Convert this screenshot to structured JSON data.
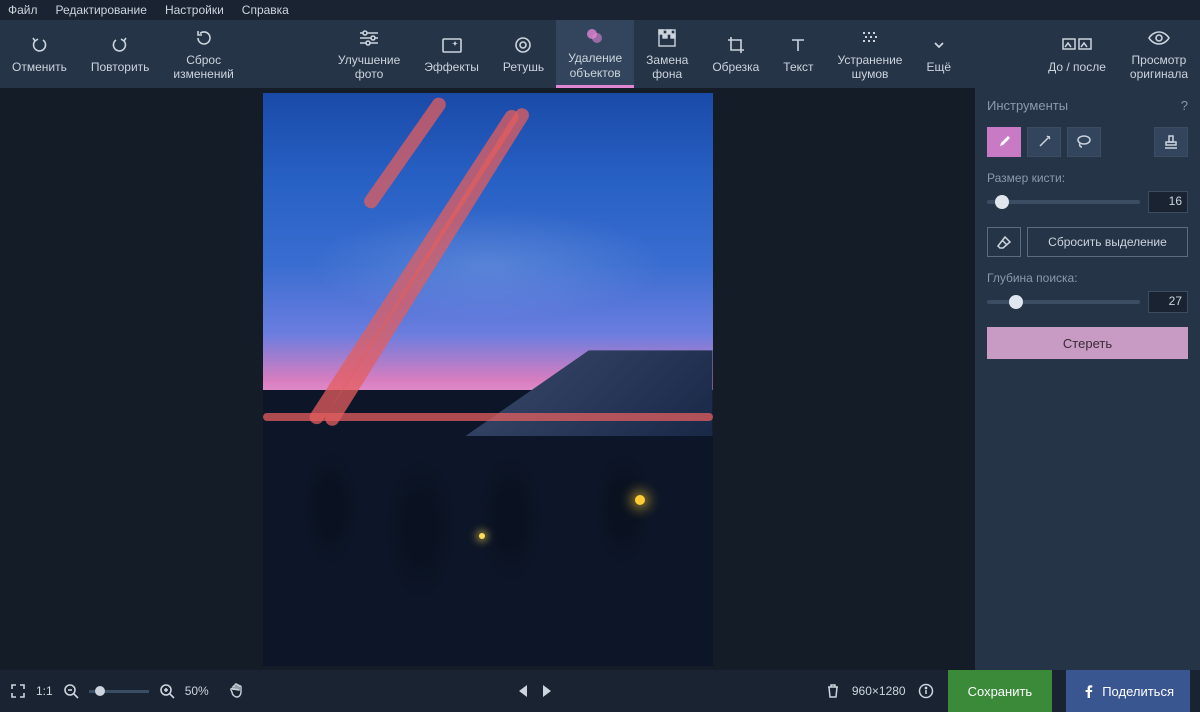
{
  "menu": {
    "file": "Файл",
    "edit": "Редактирование",
    "settings": "Настройки",
    "help": "Справка"
  },
  "toolbar": {
    "undo": "Отменить",
    "redo": "Повторить",
    "reset": "Сброс\nизменений",
    "enhance": "Улучшение\nфото",
    "effects": "Эффекты",
    "retouch": "Ретушь",
    "object_removal": "Удаление\nобъектов",
    "bg_removal": "Замена\nфона",
    "crop": "Обрезка",
    "text": "Текст",
    "denoise": "Устранение\nшумов",
    "more": "Ещё",
    "before_after": "До / после",
    "view_original": "Просмотр\nоригинала"
  },
  "panel": {
    "title": "Инструменты",
    "brush_size_label": "Размер кисти:",
    "brush_size_value": "16",
    "reset_selection": "Сбросить выделение",
    "search_depth_label": "Глубина поиска:",
    "search_depth_value": "27",
    "erase": "Стереть"
  },
  "bottom": {
    "scale_1_1": "1:1",
    "zoom_percent": "50%",
    "dimensions": "960×1280",
    "save": "Сохранить",
    "share": "Поделиться"
  }
}
